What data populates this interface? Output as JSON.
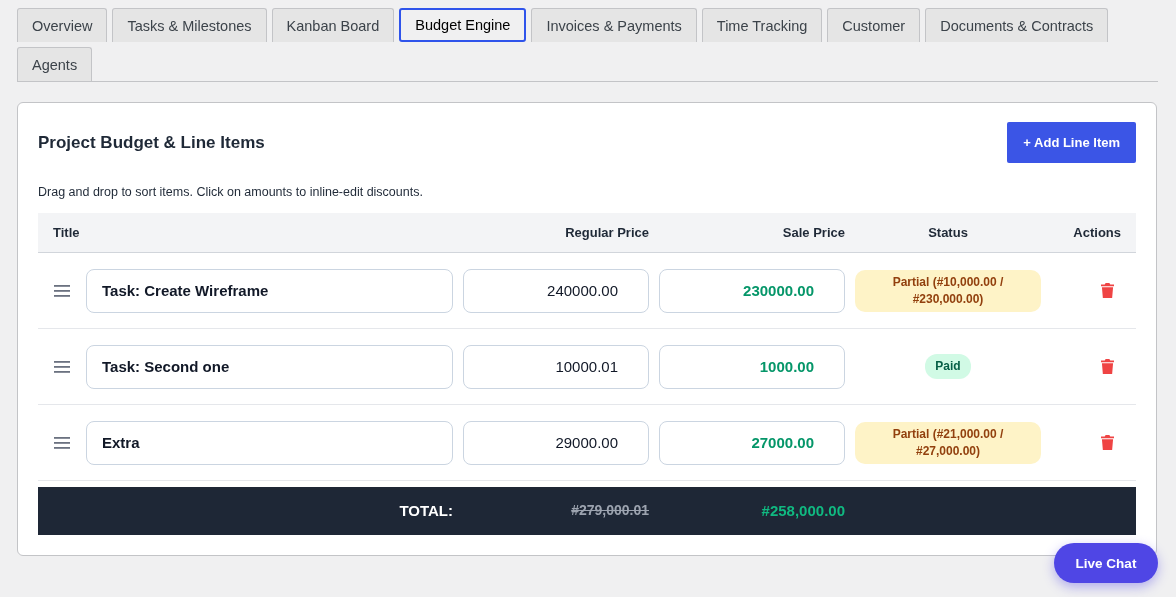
{
  "tabs": [
    {
      "label": "Overview",
      "selected": false
    },
    {
      "label": "Tasks & Milestones",
      "selected": false
    },
    {
      "label": "Kanban Board",
      "selected": false
    },
    {
      "label": "Budget Engine",
      "selected": true
    },
    {
      "label": "Invoices & Payments",
      "selected": false
    },
    {
      "label": "Time Tracking",
      "selected": false
    },
    {
      "label": "Customer",
      "selected": false
    },
    {
      "label": "Documents & Contracts",
      "selected": false
    },
    {
      "label": "Agents",
      "selected": false
    }
  ],
  "card": {
    "title": "Project Budget & Line Items",
    "add_button": "+ Add Line Item",
    "hint": "Drag and drop to sort items. Click on amounts to inline-edit discounts."
  },
  "table": {
    "columns": [
      "Title",
      "Regular Price",
      "Sale Price",
      "Status",
      "Actions"
    ],
    "rows": [
      {
        "title": "Task: Create Wireframe",
        "regular_price": "240000.00",
        "sale_price": "230000.00",
        "status": {
          "kind": "partial",
          "text": "Partial (#10,000.00 / #230,000.00)"
        }
      },
      {
        "title": "Task: Second one",
        "regular_price": "10000.01",
        "sale_price": "1000.00",
        "status": {
          "kind": "paid",
          "text": "Paid"
        }
      },
      {
        "title": "Extra",
        "regular_price": "29000.00",
        "sale_price": "27000.00",
        "status": {
          "kind": "partial",
          "text": "Partial (#21,000.00 / #27,000.00)"
        }
      }
    ],
    "total": {
      "label": "TOTAL:",
      "regular": "#279,000.01",
      "sale": "#258,000.00"
    }
  },
  "live_chat": "Live Chat"
}
